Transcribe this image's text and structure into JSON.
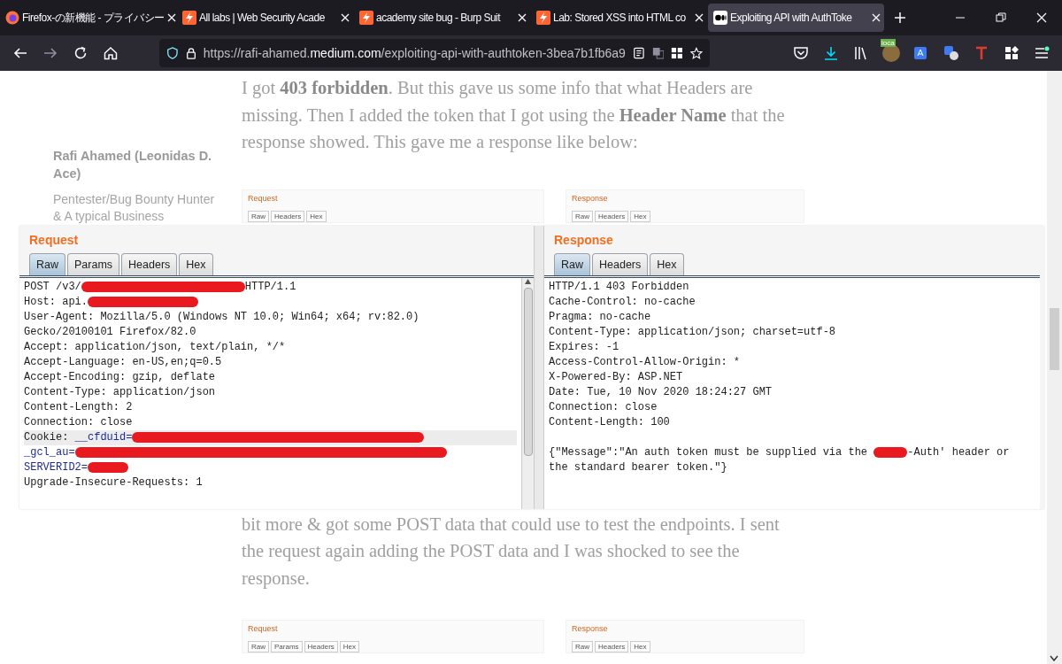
{
  "browser": {
    "tabs": [
      {
        "title": "Firefox-の新機能 - プライバシー",
        "kind": "firefox",
        "selected": false
      },
      {
        "title": "All labs | Web Security Acade",
        "kind": "burp",
        "selected": false
      },
      {
        "title": "academy site bug - Burp Suit",
        "kind": "burp",
        "selected": false
      },
      {
        "title": "Lab: Stored XSS into HTML co",
        "kind": "burp",
        "selected": false
      },
      {
        "title": "Exploiting API with AuthToke",
        "kind": "medium",
        "selected": true
      }
    ],
    "url": {
      "prefix": "https://rafi-ahamed.",
      "domain": "medium.com",
      "path": "/exploiting-api-with-authtoken-3bea7b1fb6a9"
    },
    "extension_badge": "loca"
  },
  "article": {
    "author": "Rafi Ahamed (Leonidas D. Ace)",
    "bio": "Pentester/Bug Bounty Hunter & A typical Business",
    "paragraph_top": "I got **403 forbidden**. But this gave us some info that what Headers are missing. Then I added the token that I got using the **Header Name** that the response showed. This gave me a response like below:",
    "thumbnails_top": [
      {
        "title": "Request",
        "tabs": [
          "Raw",
          "Headers",
          "Hex"
        ]
      },
      {
        "title": "Response",
        "tabs": [
          "Raw",
          "Headers",
          "Hex"
        ]
      }
    ],
    "paragraph_bottom": "bit more & got some POST data that could use to test the endpoints. I sent the request again adding the POST data and I was shocked to see the response.",
    "thumbnails_bottom": [
      {
        "title": "Request",
        "tabs": [
          "Raw",
          "Params",
          "Headers",
          "Hex"
        ]
      },
      {
        "title": "Response",
        "tabs": [
          "Raw",
          "Headers",
          "Hex"
        ]
      }
    ]
  },
  "lightbox": {
    "request": {
      "title": "Request",
      "tabs": [
        {
          "label": "Raw",
          "selected": true
        },
        {
          "label": "Params",
          "selected": false
        },
        {
          "label": "Headers",
          "selected": false
        },
        {
          "label": "Hex",
          "selected": false
        }
      ],
      "lines": [
        {
          "highlighted": false,
          "parts": [
            {
              "kind": "text",
              "text": "POST /v3/"
            },
            {
              "kind": "redaction"
            },
            {
              "kind": "text",
              "text": "HTTP/1.1"
            }
          ]
        },
        {
          "highlighted": false,
          "parts": [
            {
              "kind": "text",
              "text": "Host: api."
            },
            {
              "kind": "redaction"
            }
          ]
        },
        {
          "highlighted": false,
          "parts": [
            {
              "kind": "text",
              "text": "User-Agent: Mozilla/5.0 (Windows NT 10.0; Win64; x64; rv:82.0)"
            }
          ]
        },
        {
          "highlighted": false,
          "parts": [
            {
              "kind": "text",
              "text": "Gecko/20100101 Firefox/82.0"
            }
          ]
        },
        {
          "highlighted": false,
          "parts": [
            {
              "kind": "text",
              "text": "Accept: application/json, text/plain, */*"
            }
          ]
        },
        {
          "highlighted": false,
          "parts": [
            {
              "kind": "text",
              "text": "Accept-Language: en-US,en;q=0.5"
            }
          ]
        },
        {
          "highlighted": false,
          "parts": [
            {
              "kind": "text",
              "text": "Accept-Encoding: gzip, deflate"
            }
          ]
        },
        {
          "highlighted": false,
          "parts": [
            {
              "kind": "text",
              "text": "Content-Type: application/json"
            }
          ]
        },
        {
          "highlighted": false,
          "parts": [
            {
              "kind": "text",
              "text": "Content-Length: 2"
            }
          ]
        },
        {
          "highlighted": false,
          "parts": [
            {
              "kind": "text",
              "text": "Connection: close"
            }
          ]
        },
        {
          "highlighted": true,
          "parts": [
            {
              "kind": "text",
              "text": "Cookie: "
            },
            {
              "kind": "param",
              "text": "__cfduid="
            },
            {
              "kind": "redaction"
            }
          ]
        },
        {
          "highlighted": false,
          "parts": [
            {
              "kind": "param",
              "text": "_gcl_au="
            },
            {
              "kind": "redaction"
            }
          ]
        },
        {
          "highlighted": false,
          "parts": [
            {
              "kind": "param",
              "text": "SERVERID2="
            },
            {
              "kind": "redaction"
            }
          ]
        },
        {
          "highlighted": false,
          "parts": [
            {
              "kind": "text",
              "text": "Upgrade-Insecure-Requests: 1"
            }
          ]
        }
      ]
    },
    "response": {
      "title": "Response",
      "tabs": [
        {
          "label": "Raw",
          "selected": true
        },
        {
          "label": "Headers",
          "selected": false
        },
        {
          "label": "Hex",
          "selected": false
        }
      ],
      "lines": [
        {
          "highlighted": false,
          "parts": [
            {
              "kind": "text",
              "text": "HTTP/1.1 403 Forbidden"
            }
          ]
        },
        {
          "highlighted": false,
          "parts": [
            {
              "kind": "text",
              "text": "Cache-Control: no-cache"
            }
          ]
        },
        {
          "highlighted": false,
          "parts": [
            {
              "kind": "text",
              "text": "Pragma: no-cache"
            }
          ]
        },
        {
          "highlighted": false,
          "parts": [
            {
              "kind": "text",
              "text": "Content-Type: application/json; charset=utf-8"
            }
          ]
        },
        {
          "highlighted": false,
          "parts": [
            {
              "kind": "text",
              "text": "Expires: -1"
            }
          ]
        },
        {
          "highlighted": false,
          "parts": [
            {
              "kind": "text",
              "text": "Access-Control-Allow-Origin: *"
            }
          ]
        },
        {
          "highlighted": false,
          "parts": [
            {
              "kind": "text",
              "text": "X-Powered-By: ASP.NET"
            }
          ]
        },
        {
          "highlighted": false,
          "parts": [
            {
              "kind": "text",
              "text": "Date: Tue, 10 Nov 2020 18:24:27 GMT"
            }
          ]
        },
        {
          "highlighted": false,
          "parts": [
            {
              "kind": "text",
              "text": "Connection: close"
            }
          ]
        },
        {
          "highlighted": false,
          "parts": [
            {
              "kind": "text",
              "text": "Content-Length: 100"
            }
          ]
        },
        {
          "highlighted": false
        },
        {
          "highlighted": false,
          "parts": [
            {
              "kind": "text",
              "text": "{\"Message\":\"An auth token must be supplied via the "
            },
            {
              "kind": "redaction"
            },
            {
              "kind": "text",
              "text": "-Auth' header or"
            }
          ]
        },
        {
          "highlighted": false,
          "parts": [
            {
              "kind": "text",
              "text": "the standard bearer token.\"}"
            }
          ]
        }
      ]
    }
  }
}
